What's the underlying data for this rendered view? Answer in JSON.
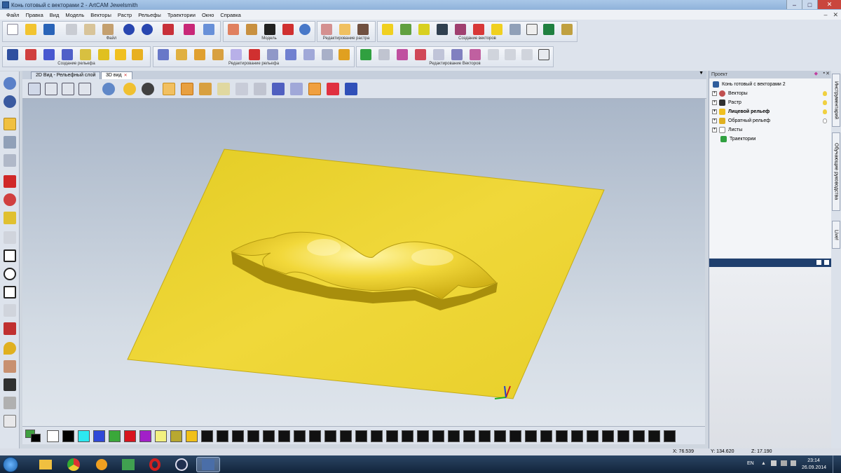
{
  "window": {
    "title": "Конь готовый с векторами 2 - ArtCAM Jewelsmith",
    "controls": [
      "–",
      "□",
      "✕"
    ]
  },
  "menu": [
    "Файл",
    "Правка",
    "Вид",
    "Модель",
    "Векторы",
    "Растр",
    "Рельефы",
    "Траектории",
    "Окно",
    "Справка"
  ],
  "toolbars": {
    "row1": {
      "file_label": "Файл",
      "model_label": "Модель",
      "raster_edit_label": "Редактирование растра",
      "vector_create_label": "Создание векторов"
    },
    "row2": {
      "relief_create_label": "Создание рельефа",
      "relief_edit_label": "Редактирование рельефа",
      "vector_edit_label": "Редактирование Векторов"
    }
  },
  "view_tabs": [
    {
      "label": "2D Вид - Рельефный слой",
      "active": false
    },
    {
      "label": "3D вид",
      "active": true
    }
  ],
  "palette": [
    "#40a040",
    "#ffffff",
    "#000000",
    "#2ce8f0",
    "#2f48d8",
    "#3aa83a",
    "#d8141e",
    "#a220c8",
    "#f2f080",
    "#b8a830",
    "#f0c018"
  ],
  "project": {
    "panel_title": "Проект",
    "root": "Конь готовый с векторами 2",
    "items": [
      {
        "label": "Векторы",
        "bold": false
      },
      {
        "label": "Растр",
        "bold": false
      },
      {
        "label": "Лицевой рельеф",
        "bold": true
      },
      {
        "label": "Обратный рельеф",
        "bold": false
      },
      {
        "label": "Листы",
        "bold": false
      },
      {
        "label": "Траектории",
        "bold": false
      }
    ]
  },
  "side_tabs": [
    "Инструментарий",
    "Обучающие руководства",
    "Live!"
  ],
  "status": {
    "x": "X: 76.539",
    "y": "Y: 134.620",
    "z": "Z: 17.190"
  },
  "taskbar": {
    "lang": "EN",
    "time": "23:14",
    "date": "26.09.2014"
  }
}
